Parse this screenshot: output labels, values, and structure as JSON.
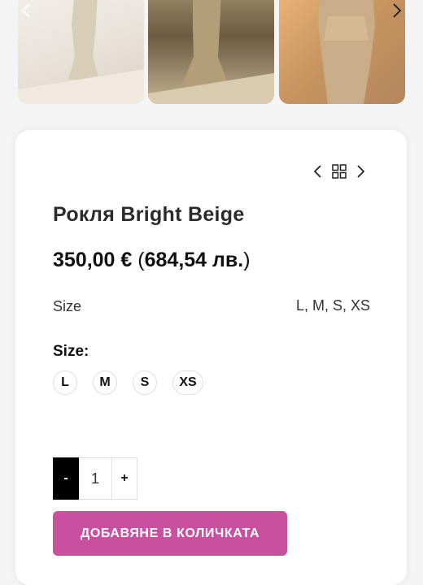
{
  "gallery": {
    "thumbnails": [
      {
        "alt": "dress-thumbnail-1"
      },
      {
        "alt": "dress-thumbnail-2"
      },
      {
        "alt": "dress-thumbnail-3"
      }
    ],
    "prev_icon": "chevron-left-icon",
    "next_icon": "chevron-right-icon"
  },
  "product": {
    "title": "Рокля Bright Beige",
    "price_eur": "350,00 €",
    "price_bgn_open": " (",
    "price_bgn": "684,54 лв.",
    "price_bgn_close": ")",
    "attribute_label": "Size",
    "attribute_value": "L, M, S, XS",
    "size_heading": "Size:",
    "sizes": [
      "L",
      "M",
      "S",
      "XS"
    ]
  },
  "navigation": {
    "prev_icon": "chevron-left-icon",
    "grid_icon": "grid-icon",
    "next_icon": "chevron-right-icon"
  },
  "cart": {
    "minus_label": "-",
    "quantity": "1",
    "plus_label": "+",
    "add_to_cart_label": "ДОБАВЯНЕ В КОЛИЧКАТА"
  },
  "colors": {
    "accent": "#c94f9f",
    "minus_button": "#000000"
  }
}
